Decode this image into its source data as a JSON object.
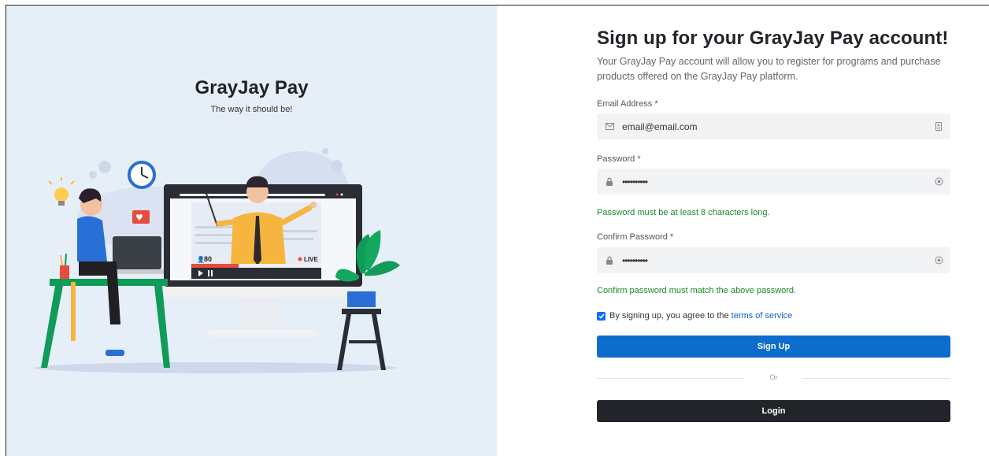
{
  "brand": {
    "name": "GrayJay Pay",
    "tagline": "The way it should be!"
  },
  "illustration": {
    "viewers": "80",
    "live": "LIVE"
  },
  "form": {
    "title": "Sign up for your GrayJay Pay account!",
    "subtitle": "Your GrayJay Pay account will allow you to register for programs and purchase products offered on the GrayJay Pay platform.",
    "email": {
      "label": "Email Address *",
      "value": "email@email.com"
    },
    "password": {
      "label": "Password *",
      "value": "••••••••••",
      "hint": "Password must be at least 8 characters long."
    },
    "confirm": {
      "label": "Confirm Password *",
      "value": "••••••••••",
      "hint": "Confirm password must match the above password."
    },
    "agree": {
      "text": "By signing up, you agree to the",
      "link": "terms of service",
      "checked": true
    },
    "signup_label": "Sign Up",
    "or_label": "Or",
    "login_label": "Login"
  },
  "colors": {
    "accent": "#0d6ccc",
    "dark": "#212529",
    "hint": "#1a8a2a",
    "panel": "#e6eef8"
  }
}
